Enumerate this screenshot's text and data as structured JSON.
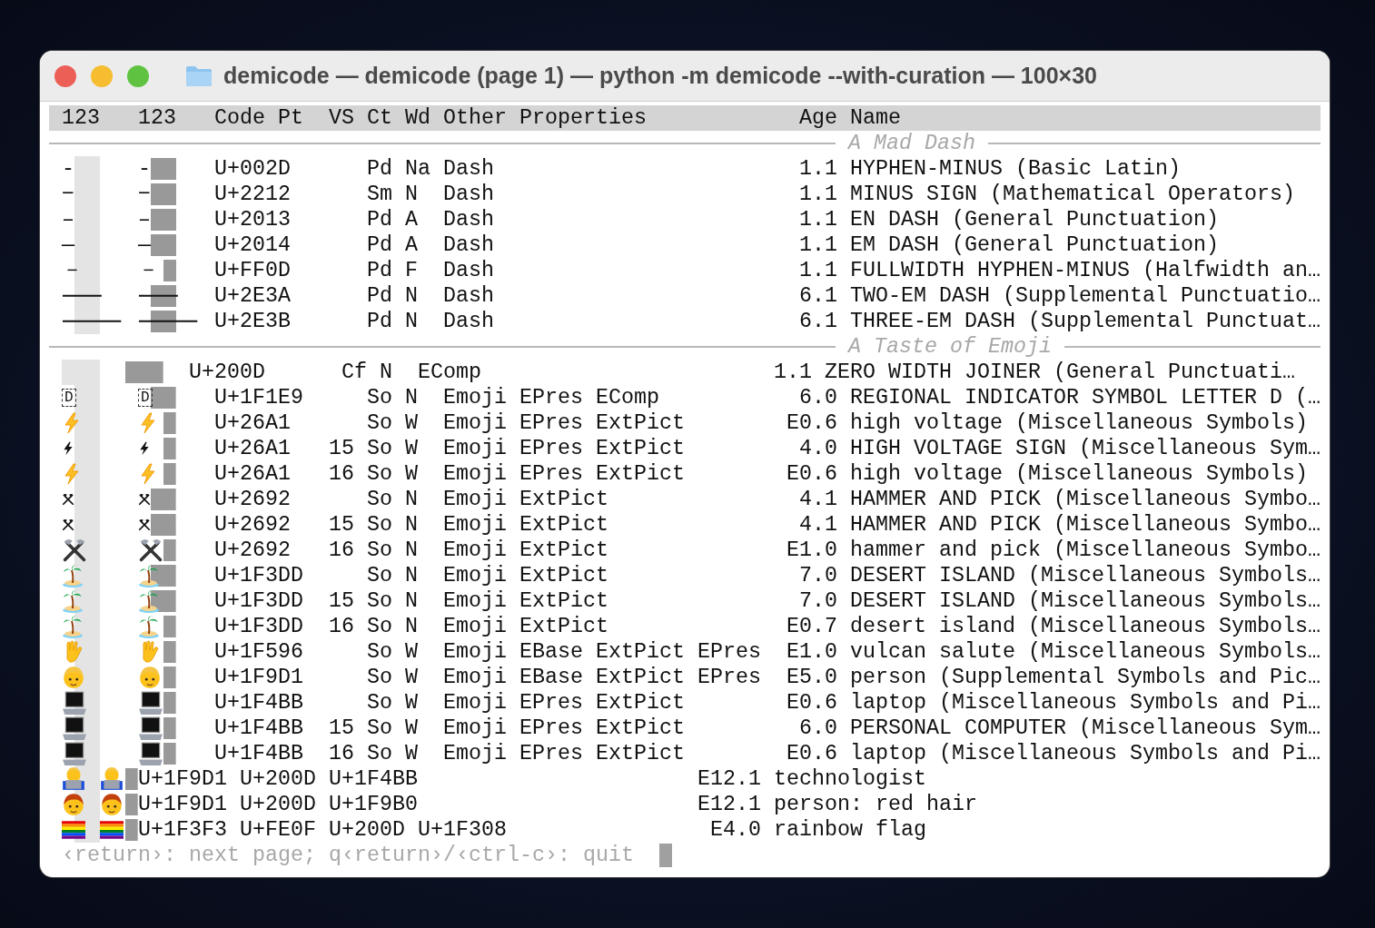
{
  "window": {
    "title": "demicode — demicode (page 1) — python -m demicode --with-curation — 100×30"
  },
  "header": [
    "123",
    "123",
    "Code Pt",
    "VS",
    "Ct",
    "Wd",
    "Other Properties",
    "Age",
    "Name"
  ],
  "sections": [
    {
      "title": "A Mad Dash",
      "rows": [
        {
          "kind": "text",
          "wide": false,
          "glyph_1": "-",
          "glyph_2": "-",
          "code": "U+002D",
          "category": "Pd",
          "width": "Na",
          "properties": "Dash",
          "age": "1.1",
          "name": "HYPHEN-MINUS (Basic Latin)"
        },
        {
          "kind": "text",
          "wide": false,
          "glyph_1": "−",
          "glyph_2": "−",
          "code": "U+2212",
          "category": "Sm",
          "width": "N",
          "properties": "Dash",
          "age": "1.1",
          "name": "MINUS SIGN (Mathematical Operators)"
        },
        {
          "kind": "text",
          "wide": false,
          "glyph_1": "–",
          "glyph_2": "–",
          "code": "U+2013",
          "category": "Pd",
          "width": "A",
          "properties": "Dash",
          "age": "1.1",
          "name": "EN DASH (General Punctuation)"
        },
        {
          "kind": "text",
          "wide": false,
          "glyph_1": "—",
          "glyph_2": "—",
          "code": "U+2014",
          "category": "Pd",
          "width": "A",
          "properties": "Dash",
          "age": "1.1",
          "name": "EM DASH (General Punctuation)"
        },
        {
          "kind": "text",
          "wide": true,
          "glyph_1": "－",
          "glyph_2": "－",
          "code": "U+FF0D",
          "category": "Pd",
          "width": "F",
          "properties": "Dash",
          "age": "1.1",
          "name": "FULLWIDTH HYPHEN-MINUS (Halfwidth an…"
        },
        {
          "kind": "text",
          "wide": false,
          "glyph_1": "⸺",
          "glyph_2": "⸺",
          "code": "U+2E3A",
          "category": "Pd",
          "width": "N",
          "properties": "Dash",
          "age": "6.1",
          "name": "TWO-EM DASH (Supplemental Punctuatio…"
        },
        {
          "kind": "text",
          "wide": false,
          "glyph_1": "⸻",
          "glyph_2": "⸻",
          "code": "U+2E3B",
          "category": "Pd",
          "width": "N",
          "properties": "Dash",
          "age": "6.1",
          "name": "THREE-EM DASH (Supplemental Punctuat…"
        }
      ]
    },
    {
      "title": "A Taste of Emoji",
      "rows": [
        {
          "kind": "blank",
          "code": "U+200D",
          "category": "Cf",
          "width": "N",
          "properties": "EComp",
          "age": "1.1",
          "name": "ZERO WIDTH JOINER (General Punctuati…"
        },
        {
          "kind": "boxed",
          "wide": false,
          "glyph_1": "D",
          "glyph_2": "D",
          "code": "U+1F1E9",
          "category": "So",
          "width": "N",
          "properties": "Emoji EPres EComp",
          "age": "6.0",
          "name": "REGIONAL INDICATOR SYMBOL LETTER D (…"
        },
        {
          "kind": "bolt-color",
          "wide": true,
          "code": "U+26A1",
          "category": "So",
          "width": "W",
          "properties": "Emoji EPres ExtPict",
          "age": "E0.6",
          "name": "high voltage (Miscellaneous Symbols)"
        },
        {
          "kind": "bolt",
          "wide": true,
          "code": "U+26A1",
          "vs": "15",
          "category": "So",
          "width": "W",
          "properties": "Emoji EPres ExtPict",
          "age": "4.0",
          "name": "HIGH VOLTAGE SIGN (Miscellaneous Sym…"
        },
        {
          "kind": "bolt-color",
          "wide": true,
          "code": "U+26A1",
          "vs": "16",
          "category": "So",
          "width": "W",
          "properties": "Emoji EPres ExtPict",
          "age": "E0.6",
          "name": "high voltage (Miscellaneous Symbols)"
        },
        {
          "kind": "hammer",
          "wide": false,
          "code": "U+2692",
          "category": "So",
          "width": "N",
          "properties": "Emoji ExtPict",
          "age": "4.1",
          "name": "HAMMER AND PICK (Miscellaneous Symbo…"
        },
        {
          "kind": "hammer",
          "wide": false,
          "code": "U+2692",
          "vs": "15",
          "category": "So",
          "width": "N",
          "properties": "Emoji ExtPict",
          "age": "4.1",
          "name": "HAMMER AND PICK (Miscellaneous Symbo…"
        },
        {
          "kind": "hammer-color",
          "wide": true,
          "code": "U+2692",
          "vs": "16",
          "category": "So",
          "width": "N",
          "properties": "Emoji ExtPict",
          "age": "E1.0",
          "name": "hammer and pick (Miscellaneous Symbo…"
        },
        {
          "kind": "island",
          "wide": false,
          "code": "U+1F3DD",
          "category": "So",
          "width": "N",
          "properties": "Emoji ExtPict",
          "age": "7.0",
          "name": "DESERT ISLAND (Miscellaneous Symbols…"
        },
        {
          "kind": "island",
          "wide": false,
          "code": "U+1F3DD",
          "vs": "15",
          "category": "So",
          "width": "N",
          "properties": "Emoji ExtPict",
          "age": "7.0",
          "name": "DESERT ISLAND (Miscellaneous Symbols…"
        },
        {
          "kind": "island",
          "wide": true,
          "code": "U+1F3DD",
          "vs": "16",
          "category": "So",
          "width": "N",
          "properties": "Emoji ExtPict",
          "age": "E0.7",
          "name": "desert island (Miscellaneous Symbols…"
        },
        {
          "kind": "hand",
          "wide": true,
          "code": "U+1F596",
          "category": "So",
          "width": "W",
          "properties": "Emoji EBase ExtPict EPres",
          "age": "E1.0",
          "name": "vulcan salute (Miscellaneous Symbols…"
        },
        {
          "kind": "person",
          "wide": true,
          "code": "U+1F9D1",
          "category": "So",
          "width": "W",
          "properties": "Emoji EBase ExtPict EPres",
          "age": "E5.0",
          "name": "person (Supplemental Symbols and Pic…"
        },
        {
          "kind": "laptop",
          "wide": true,
          "code": "U+1F4BB",
          "category": "So",
          "width": "W",
          "properties": "Emoji EPres ExtPict",
          "age": "E0.6",
          "name": "laptop (Miscellaneous Symbols and Pi…"
        },
        {
          "kind": "laptop",
          "wide": true,
          "code": "U+1F4BB",
          "vs": "15",
          "category": "So",
          "width": "W",
          "properties": "Emoji EPres ExtPict",
          "age": "6.0",
          "name": "PERSONAL COMPUTER (Miscellaneous Sym…"
        },
        {
          "kind": "laptop",
          "wide": true,
          "code": "U+1F4BB",
          "vs": "16",
          "category": "So",
          "width": "W",
          "properties": "Emoji EPres ExtPict",
          "age": "E0.6",
          "name": "laptop (Miscellaneous Symbols and Pi…"
        },
        {
          "kind": "technologist",
          "code": "U+1F9D1 U+200D U+1F4BB",
          "age": "E12.1",
          "name": "technologist"
        },
        {
          "kind": "redhead",
          "code": "U+1F9D1 U+200D U+1F9B0",
          "age": "E12.1",
          "name": "person: red hair"
        },
        {
          "kind": "rainbow",
          "code": "U+1F3F3 U+FE0F U+200D U+1F308",
          "age": "E4.0",
          "name": "rainbow flag"
        }
      ]
    }
  ],
  "footer": {
    "prompt": "‹return›: next page; q‹return›/‹ctrl-c›: quit"
  }
}
